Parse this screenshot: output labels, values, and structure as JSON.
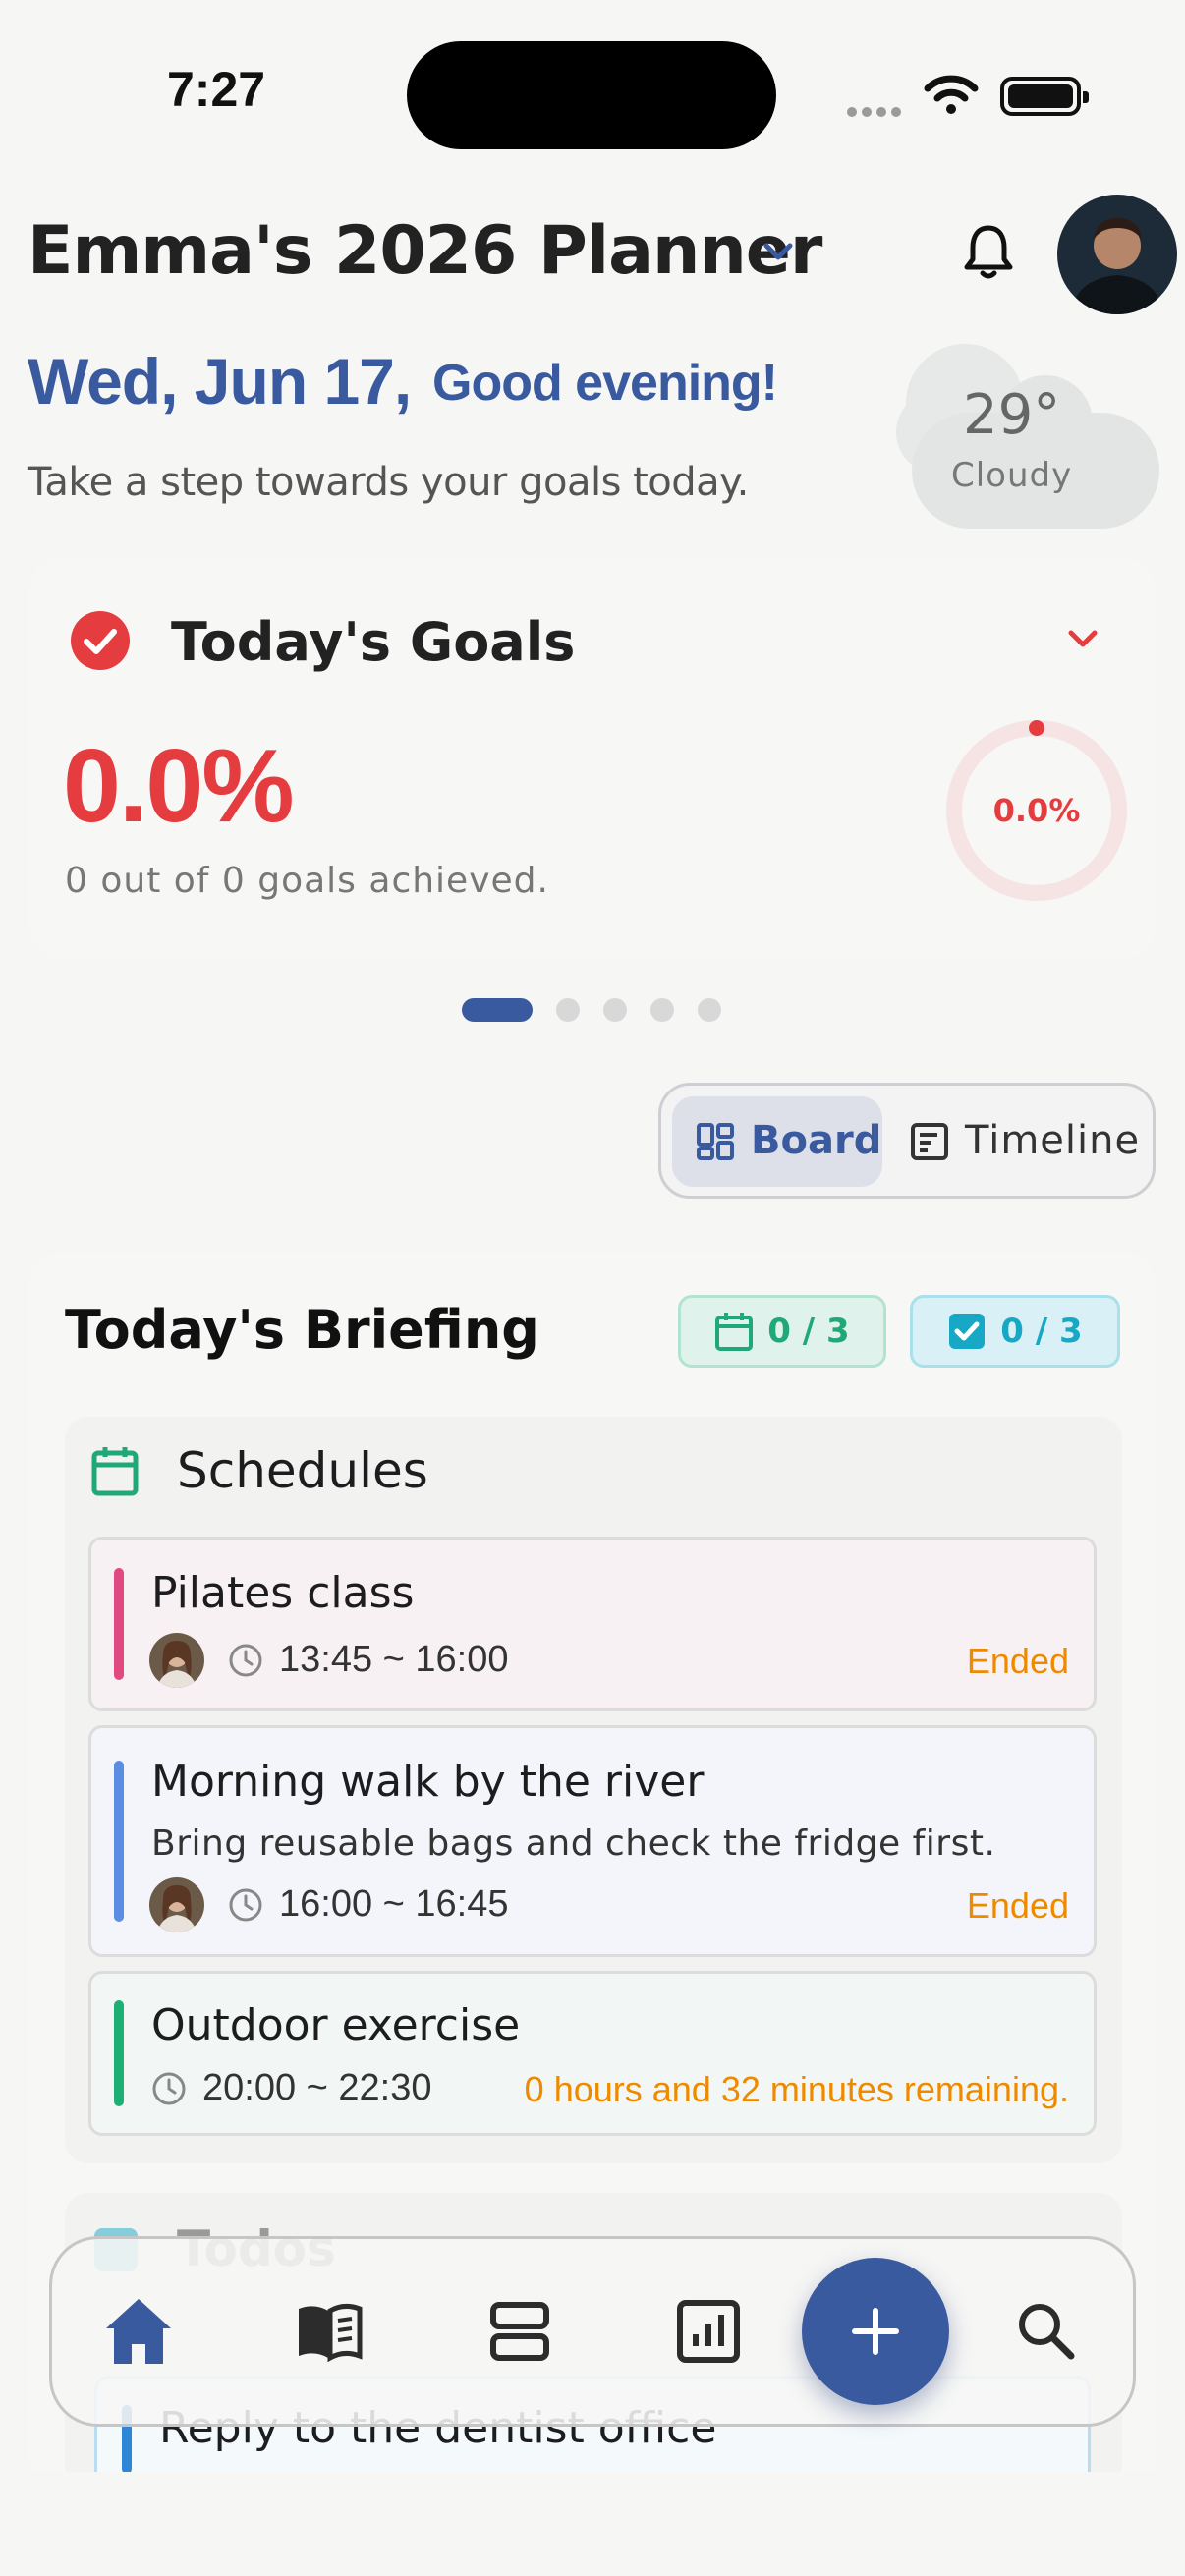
{
  "status_bar": {
    "time": "7:27"
  },
  "header": {
    "planner_title": "Emma's 2026 Planner",
    "date": "Wed, Jun 17,",
    "greeting": "Good evening!",
    "subtitle": "Take a step towards your goals today."
  },
  "weather": {
    "temperature": "29°",
    "condition": "Cloudy"
  },
  "goals": {
    "title": "Today's Goals",
    "percent": "0.0%",
    "summary": "0 out of 0 goals achieved.",
    "ring_label": "0.0%",
    "progress_fraction": 0
  },
  "carousel": {
    "count": 5,
    "active_index": 0
  },
  "view_toggle": {
    "board_label": "Board",
    "timeline_label": "Timeline",
    "selected": "Board"
  },
  "briefing": {
    "title": "Today's Briefing",
    "schedule_badge": "0 / 3",
    "todo_badge": "0 / 3",
    "schedules": {
      "title": "Schedules",
      "items": [
        {
          "title": "Pilates class",
          "time": "13:45 ~ 16:00",
          "status": "Ended",
          "color": "#e14a80"
        },
        {
          "title": "Morning walk by the river",
          "note": "Bring reusable bags and check the fridge first.",
          "time": "16:00 ~ 16:45",
          "status": "Ended",
          "color": "#5b8de3"
        },
        {
          "title": "Outdoor exercise",
          "time": "20:00 ~ 22:30",
          "status": "0 hours and 32 minutes remaining.",
          "color": "#1eaf75"
        }
      ]
    },
    "todos": {
      "title": "Todos",
      "items": [
        {
          "title": "Reply to the dentist office"
        }
      ]
    }
  },
  "bottom_nav": {
    "items": [
      "home-icon",
      "book-icon",
      "layers-icon",
      "chart-icon",
      "plus-icon",
      "search-icon"
    ],
    "active": "home-icon"
  },
  "colors": {
    "accent": "#3a5aa0",
    "danger": "#e53d3f",
    "warning": "#ee8a00",
    "schedule_green": "#20a878",
    "todo_cyan": "#17a8c6"
  }
}
